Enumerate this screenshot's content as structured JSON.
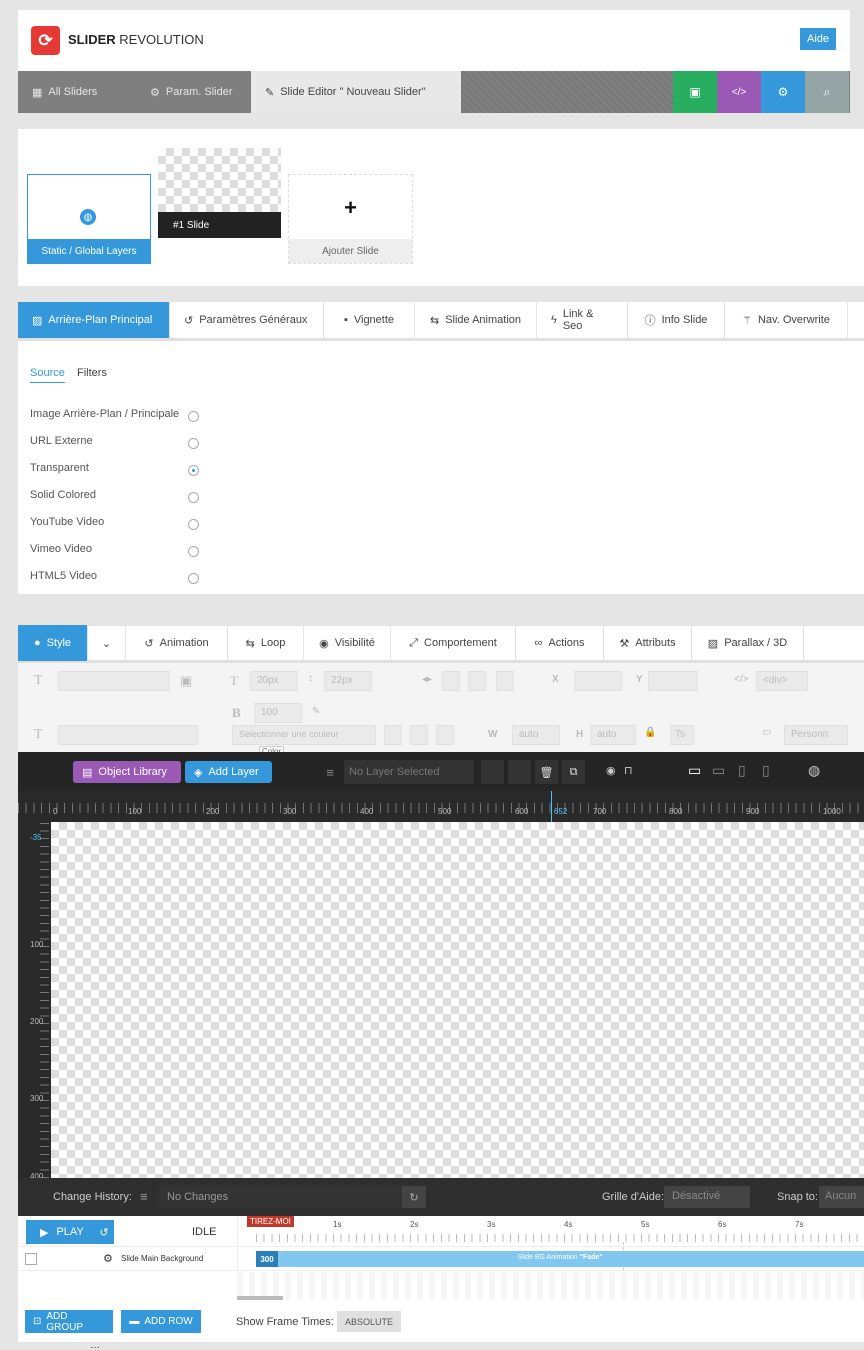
{
  "header": {
    "logo_bold": "SLIDER",
    "logo_rest": "REVOLUTION",
    "help": "Aide"
  },
  "nav": {
    "tabs": [
      "All Sliders",
      "Param. Slider",
      "Slide Editor \" Nouveau Slider\""
    ]
  },
  "slides": {
    "static_label": "Static / Global Layers",
    "slide1_label": "#1 Slide",
    "add_label": "Ajouter Slide",
    "add_plus": "+"
  },
  "bg_tabs": [
    "Arrière-Plan Principal",
    "Paramètres Généraux",
    "Vignette",
    "Slide Animation",
    "Link & Seo",
    "Info Slide",
    "Nav. Overwrite"
  ],
  "source": {
    "subtabs": [
      "Source",
      "Filters"
    ],
    "options": [
      "Image Arrière-Plan / Principale",
      "URL Externe",
      "Transparent",
      "Solid Colored",
      "YouTube Video",
      "Vimeo Video",
      "HTML5 Video"
    ],
    "selected": "Transparent"
  },
  "layer_tabs": [
    "Style",
    "Animation",
    "Loop",
    "Visibilité",
    "Comportement",
    "Actions",
    "Attributs",
    "Parallax / 3D"
  ],
  "toolbar": {
    "font_size": "20px",
    "line_height": "22px",
    "x": "X",
    "y": "Y",
    "tag": "<div>",
    "weight": "100",
    "color_ph": "Sélectionner une couleur",
    "color_tip": "Color",
    "w_label": "W",
    "w_val": "auto",
    "h_label": "H",
    "h_val": "auto",
    "ts": "Ts",
    "perso": "Personn"
  },
  "darkbar": {
    "object_library": "Object Library",
    "add_layer": "Add Layer",
    "no_layer": "No Layer Selected"
  },
  "ruler": {
    "h": [
      "0",
      "100",
      "200",
      "300",
      "400",
      "500",
      "600",
      "652",
      "700",
      "800",
      "900",
      "1000"
    ],
    "v": [
      "-35",
      "100",
      "200",
      "300",
      "400"
    ]
  },
  "history": {
    "label": "Change History:",
    "value": "No Changes",
    "grid_label": "Grille d'Aide:",
    "grid_value": "Désactivé",
    "snap_label": "Snap to:",
    "snap_value": "Aucun"
  },
  "timeline": {
    "play": "PLAY",
    "state": "IDLE",
    "marker": "TIREZ-MOI",
    "times": [
      "1s",
      "2s",
      "3s",
      "4s",
      "5s",
      "6s",
      "7s"
    ],
    "row_label": "Slide Main Background",
    "bar_start": "300",
    "bar_text": "Slide BG Animation",
    "bar_anim": "\"Fade\""
  },
  "bottom": {
    "add_group": "ADD GROUP",
    "add_row": "ADD ROW",
    "frame_label": "Show Frame Times:",
    "frame_value": "ABSOLUTE"
  },
  "colors": {
    "accent": "#3498db",
    "green": "#27ae60",
    "purple": "#9b59b6",
    "logo_red": "#e53935",
    "marker": "#c0392b"
  }
}
